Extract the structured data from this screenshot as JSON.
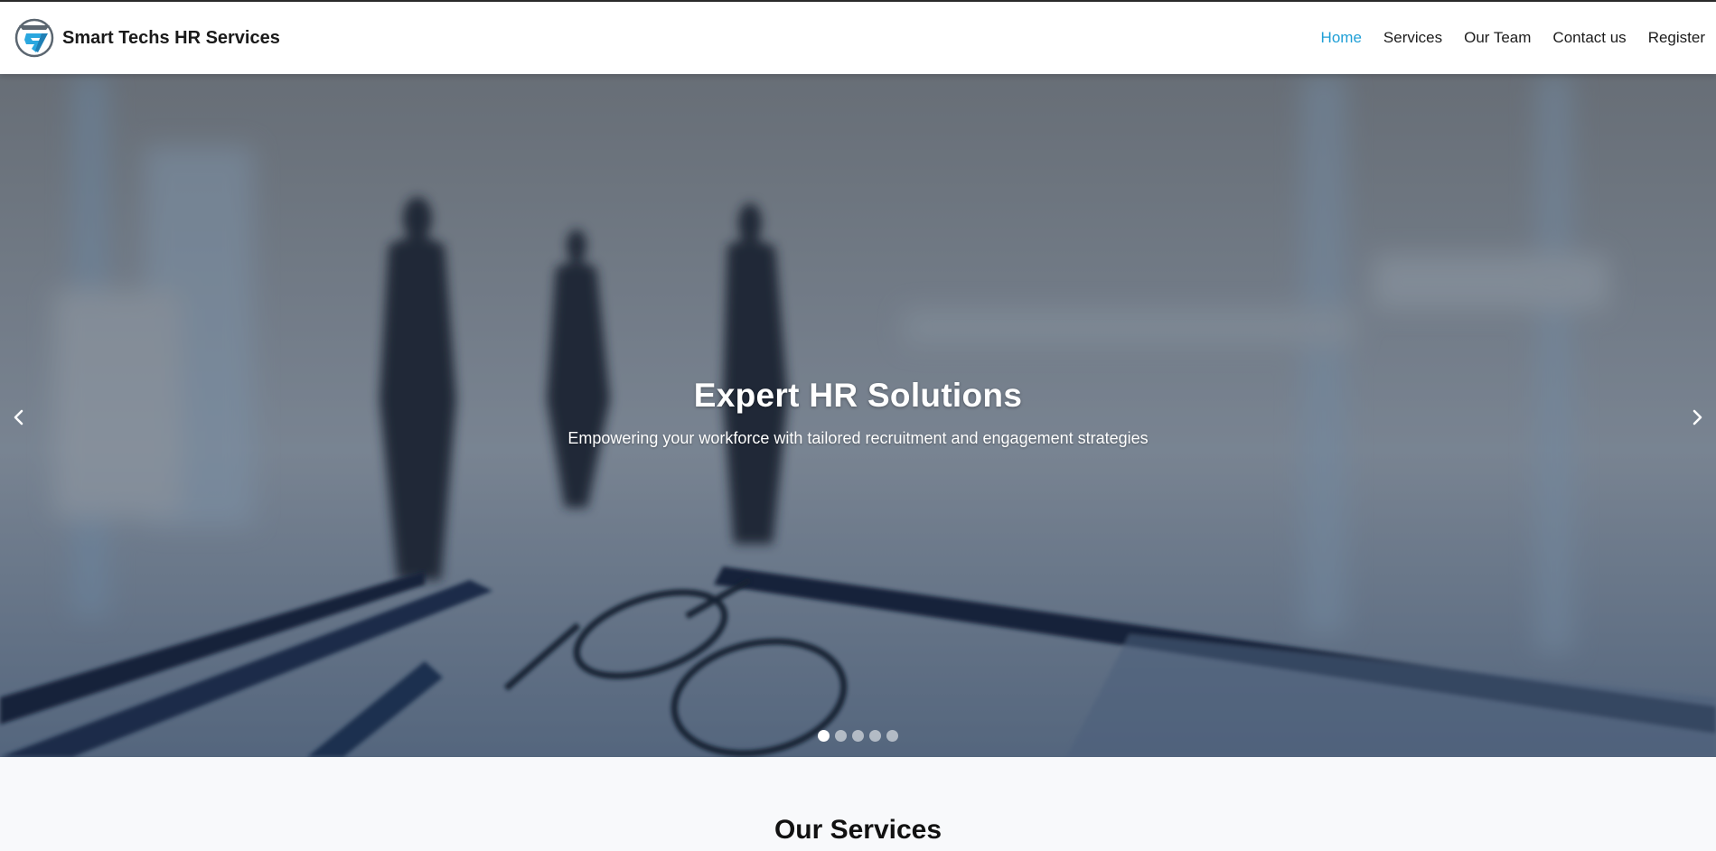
{
  "brand": {
    "name": "Smart Techs HR Services",
    "logo_icon": "st-logo-icon"
  },
  "nav": {
    "items": [
      {
        "label": "Home",
        "active": true
      },
      {
        "label": "Services",
        "active": false
      },
      {
        "label": "Our Team",
        "active": false
      },
      {
        "label": "Contact us",
        "active": false
      },
      {
        "label": "Register",
        "active": false
      }
    ],
    "active_color": "#1f9fd6"
  },
  "hero": {
    "title": "Expert HR Solutions",
    "subtitle": "Empowering your workforce with tailored recruitment and engagement strategies",
    "prev_icon": "chevron-left-icon",
    "next_icon": "chevron-right-icon",
    "slide_count": 5,
    "active_slide": 1
  },
  "services": {
    "title": "Our Services"
  }
}
